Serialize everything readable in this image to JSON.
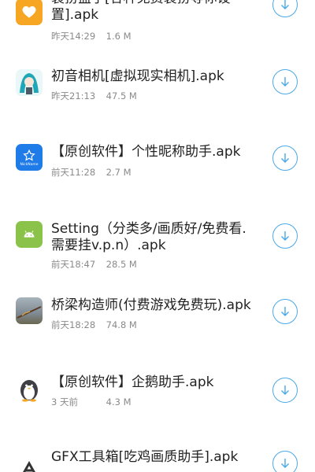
{
  "files": [
    {
      "title": "装扮盒子[各种免费装扮等你设置].apk",
      "time": "昨天14:29",
      "size": "1.6 M",
      "icon": "heart-app-icon",
      "color": "#f6a623"
    },
    {
      "title": "初音相机[虚拟现实相机].apk",
      "time": "昨天21:13",
      "size": "47.5 M",
      "icon": "miku-app-icon",
      "color": "#1ea7b6"
    },
    {
      "title": "【原创软件】个性昵称助手.apk",
      "time": "前天11:28",
      "size": "2.7 M",
      "icon": "star-app-icon",
      "color": "#1f7be8",
      "icon_text": "NickName"
    },
    {
      "title": "Setting（分类多/画质好/免费看.需要挂v.p.n）.apk",
      "time": "前天18:47",
      "size": "28.5 M",
      "icon": "android-app-icon",
      "color": "#8bc34a"
    },
    {
      "title": "桥梁构造师(付费游戏免费玩).apk",
      "time": "前天18:28",
      "size": "74.8 M",
      "icon": "bridge-app-icon",
      "color": "#7f8a93"
    },
    {
      "title": "【原创软件】企鹅助手.apk",
      "time": "3 天前",
      "size": "4.3 M",
      "icon": "penguin-app-icon",
      "color": "#ffffff"
    },
    {
      "title": "GFX工具箱[吃鸡画质助手].apk",
      "time": "",
      "size": "",
      "icon": "gfx-app-icon",
      "color": "#ffffff"
    }
  ],
  "download_icon": "download-arrow-icon",
  "accent": "#4aa8e6"
}
